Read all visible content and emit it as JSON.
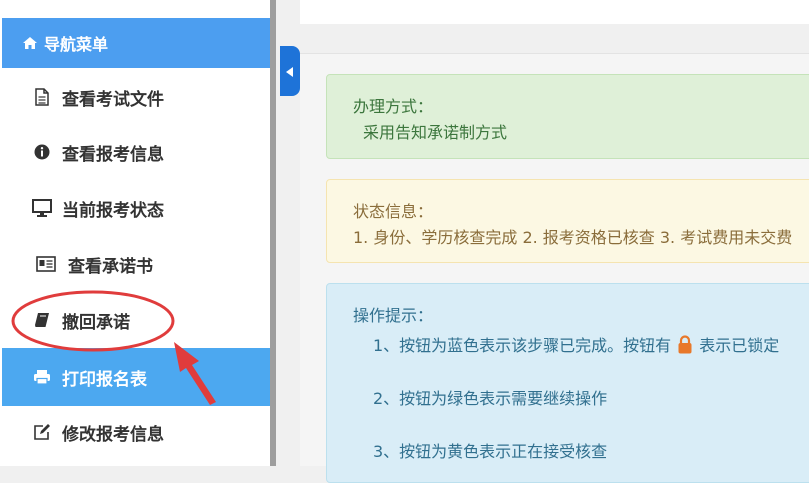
{
  "sidebar": {
    "header": {
      "label": "导航菜单",
      "icon": "home-icon"
    },
    "items": [
      {
        "label": "查看考试文件",
        "icon": "file-icon"
      },
      {
        "label": "查看报考信息",
        "icon": "info-circle-icon"
      },
      {
        "label": "当前报考状态",
        "icon": "monitor-icon"
      },
      {
        "label": "查看承诺书",
        "icon": "id-card-icon"
      },
      {
        "label": "撤回承诺",
        "icon": "book-icon"
      },
      {
        "label": "打印报名表",
        "icon": "printer-icon",
        "active": true
      },
      {
        "label": "修改报考信息",
        "icon": "edit-icon"
      }
    ]
  },
  "alerts": {
    "method": {
      "title": "办理方式：",
      "body": "采用告知承诺制方式"
    },
    "status": {
      "title": "状态信息：",
      "body": "1. 身份、学历核查完成 2. 报考资格已核查 3. 考试费用未交费"
    },
    "tips": {
      "title": "操作提示：",
      "line1_before": "1、按钮为蓝色表示该步骤已完成。按钮有",
      "line1_after": "表示已锁定",
      "line2": "2、按钮为绿色表示需要继续操作",
      "line3": "3、按钮为黄色表示正在接受核查"
    }
  },
  "colors": {
    "nav_header": "#4c9ef0",
    "nav_active": "#4ca8f0",
    "annotation_red": "#e03c3c",
    "lock_orange": "#e8782a"
  }
}
